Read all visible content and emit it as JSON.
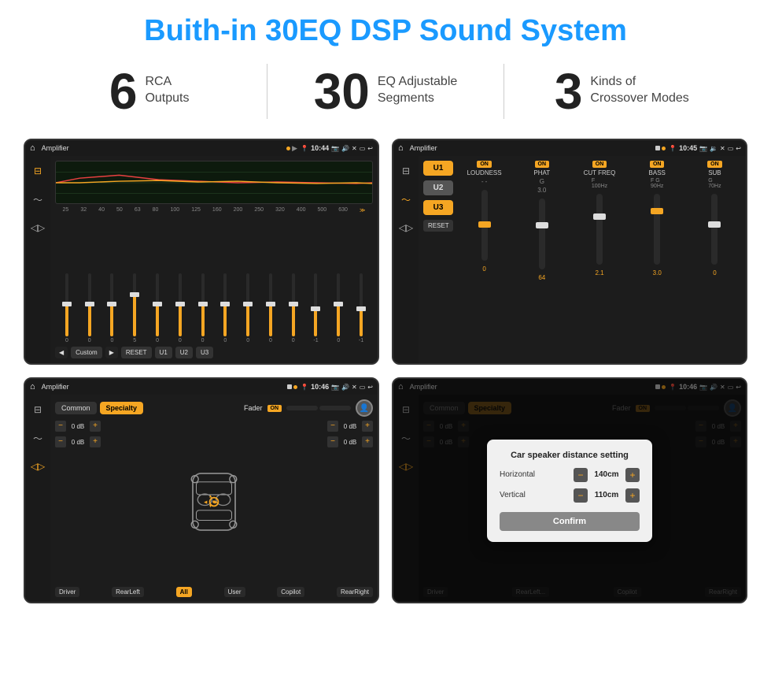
{
  "page": {
    "title": "Buith-in 30EQ DSP Sound System"
  },
  "stats": [
    {
      "number": "6",
      "text_line1": "RCA",
      "text_line2": "Outputs"
    },
    {
      "number": "30",
      "text_line1": "EQ Adjustable",
      "text_line2": "Segments"
    },
    {
      "number": "3",
      "text_line1": "Kinds of",
      "text_line2": "Crossover Modes"
    }
  ],
  "screens": {
    "eq_screen": {
      "app_name": "Amplifier",
      "time": "10:44",
      "eq_freqs": [
        "25",
        "32",
        "40",
        "50",
        "63",
        "80",
        "100",
        "125",
        "160",
        "200",
        "250",
        "320",
        "400",
        "500",
        "630"
      ],
      "eq_values": [
        "0",
        "0",
        "0",
        "5",
        "0",
        "0",
        "0",
        "0",
        "0",
        "0",
        "0",
        "-1",
        "0",
        "-1"
      ],
      "preset_label": "Custom",
      "buttons": [
        "RESET",
        "U1",
        "U2",
        "U3"
      ]
    },
    "crossover_screen": {
      "app_name": "Amplifier",
      "time": "10:45",
      "presets": [
        "U1",
        "U2",
        "U3"
      ],
      "channels": [
        {
          "name": "LOUDNESS",
          "on": true
        },
        {
          "name": "PHAT",
          "on": true
        },
        {
          "name": "CUT FREQ",
          "on": true
        },
        {
          "name": "BASS",
          "on": true
        },
        {
          "name": "SUB",
          "on": true
        }
      ],
      "reset_label": "RESET"
    },
    "fader_screen": {
      "app_name": "Amplifier",
      "time": "10:46",
      "tabs": [
        "Common",
        "Specialty"
      ],
      "active_tab": "Specialty",
      "fader_label": "Fader",
      "on_label": "ON",
      "db_values": [
        "0 dB",
        "0 dB",
        "0 dB",
        "0 dB"
      ],
      "bottom_btns": [
        "Driver",
        "RearLeft",
        "All",
        "User",
        "Copilot",
        "RearRight"
      ]
    },
    "dialog_screen": {
      "app_name": "Amplifier",
      "time": "10:46",
      "tabs": [
        "Common",
        "Specialty"
      ],
      "dialog": {
        "title": "Car speaker distance setting",
        "horizontal_label": "Horizontal",
        "horizontal_value": "140cm",
        "vertical_label": "Vertical",
        "vertical_value": "110cm",
        "confirm_label": "Confirm"
      },
      "db_values": [
        "0 dB",
        "0 dB"
      ],
      "bottom_btns": [
        "Driver",
        "RearLeft...",
        "Copilot",
        "RearRight"
      ]
    }
  }
}
